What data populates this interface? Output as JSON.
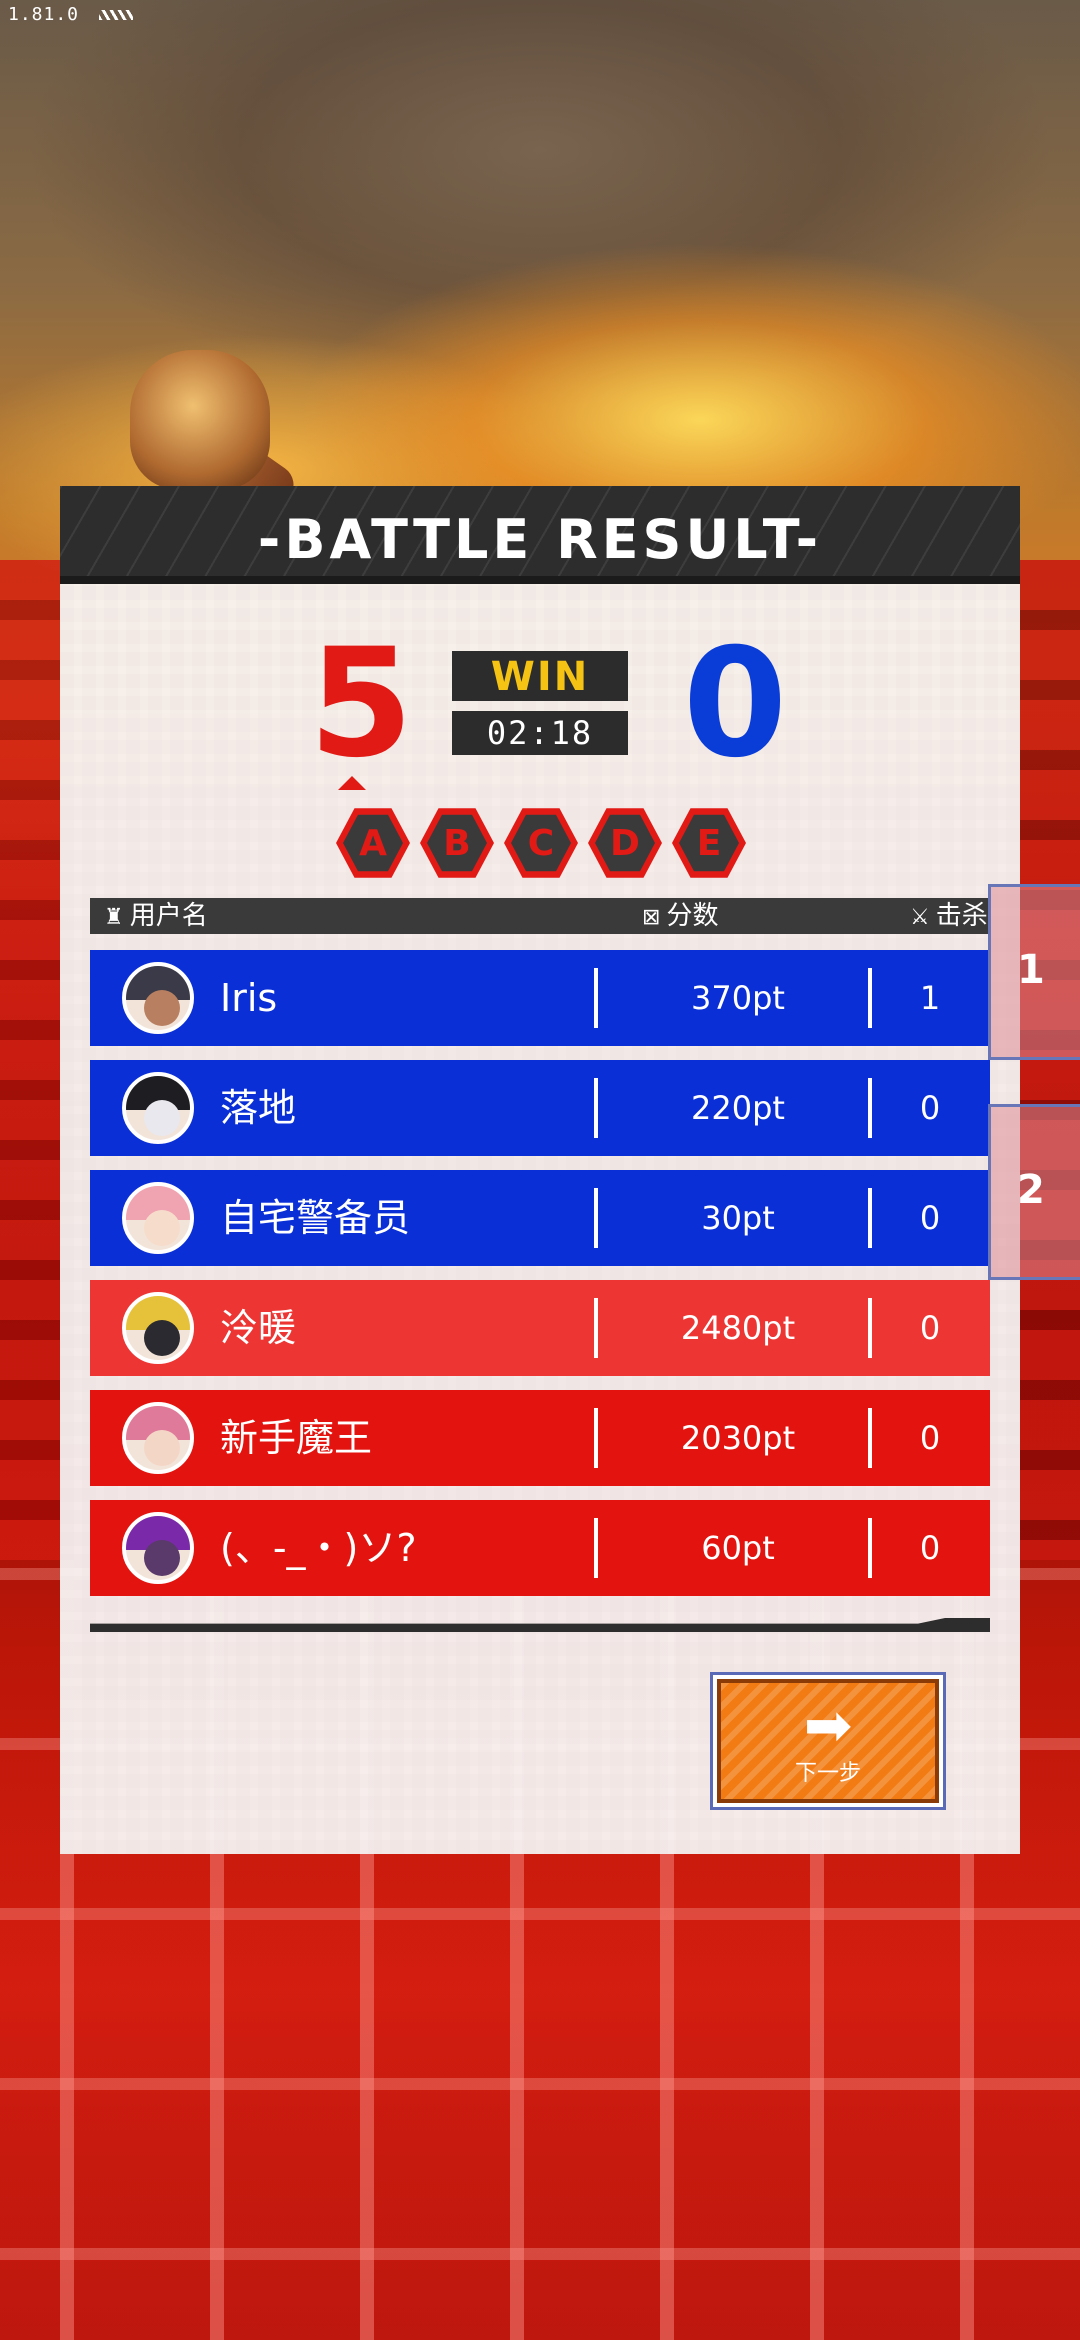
{
  "version": "1.81.0",
  "panel": {
    "title": "-BATTLE RESULT-"
  },
  "score": {
    "red": "5",
    "blue": "0",
    "result": "WIN",
    "time": "02:18"
  },
  "grades": [
    "A",
    "B",
    "C",
    "D",
    "E"
  ],
  "columns": {
    "user": "用户名",
    "score": "分数",
    "kills": "击杀"
  },
  "players": [
    {
      "team": "blue",
      "name": "Iris",
      "points": "370pt",
      "kills": "1"
    },
    {
      "team": "blue",
      "name": "落地",
      "points": "220pt",
      "kills": "0"
    },
    {
      "team": "blue",
      "name": "自宅警备员",
      "points": "30pt",
      "kills": "0"
    },
    {
      "team": "red",
      "name": "泠暖",
      "points": "2480pt",
      "kills": "0"
    },
    {
      "team": "red",
      "name": "新手魔王",
      "points": "2030pt",
      "kills": "0"
    },
    {
      "team": "red",
      "name": "(、-_・)ソ?",
      "points": "60pt",
      "kills": "0"
    }
  ],
  "next_button": {
    "label": "下一步",
    "icon": "arrow-right-icon"
  },
  "side_tabs": [
    "1",
    "2"
  ],
  "colors": {
    "red_team": "#e3140f",
    "blue_team": "#0a2fd6",
    "win": "#f4c314",
    "button": "#f27b14"
  }
}
